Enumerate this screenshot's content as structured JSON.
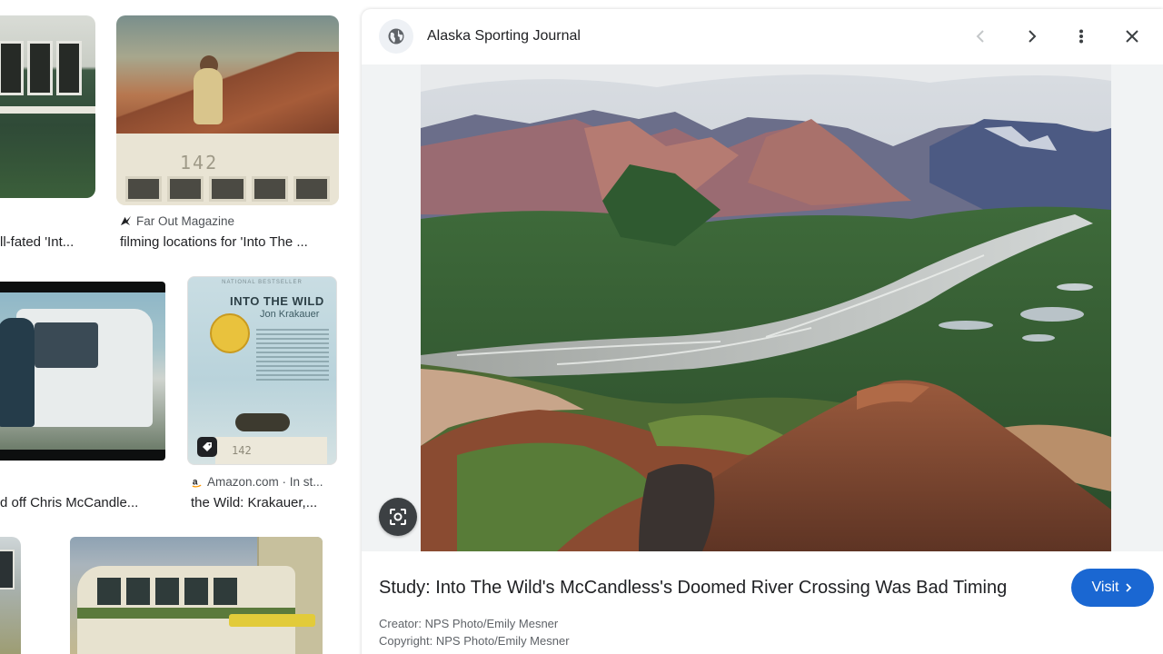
{
  "results": [
    {
      "source": "",
      "caption": "ll-fated 'Int..."
    },
    {
      "source": "Far Out Magazine",
      "caption": "filming locations for 'Into The ..."
    },
    {
      "source": "",
      "caption": "d off Chris McCandle..."
    },
    {
      "source": "Amazon.com · In st...",
      "caption": "the Wild: Krakauer,..."
    }
  ],
  "book_cover": {
    "badge": "NATIONAL BESTSELLER",
    "title": "INTO THE WILD",
    "author": "Jon Krakauer",
    "bus_number": "142"
  },
  "bus_number": "142",
  "preview": {
    "site": "Alaska Sporting Journal",
    "title": "Study: Into The Wild's McCandless's Doomed River Crossing Was Bad Timing",
    "visit_label": "Visit",
    "creator": "Creator: NPS Photo/Emily Mesner",
    "copyright": "Copyright: NPS Photo/Emily Mesner"
  },
  "icons": {
    "site": "globe-icon",
    "prev": "chevron-left-icon",
    "next": "chevron-right-icon",
    "more": "more-vert-icon",
    "close": "close-icon",
    "lens": "lens-search-icon"
  },
  "colors": {
    "visit_button": "#1a67d2",
    "text": "#202124",
    "muted": "#5f6368"
  }
}
